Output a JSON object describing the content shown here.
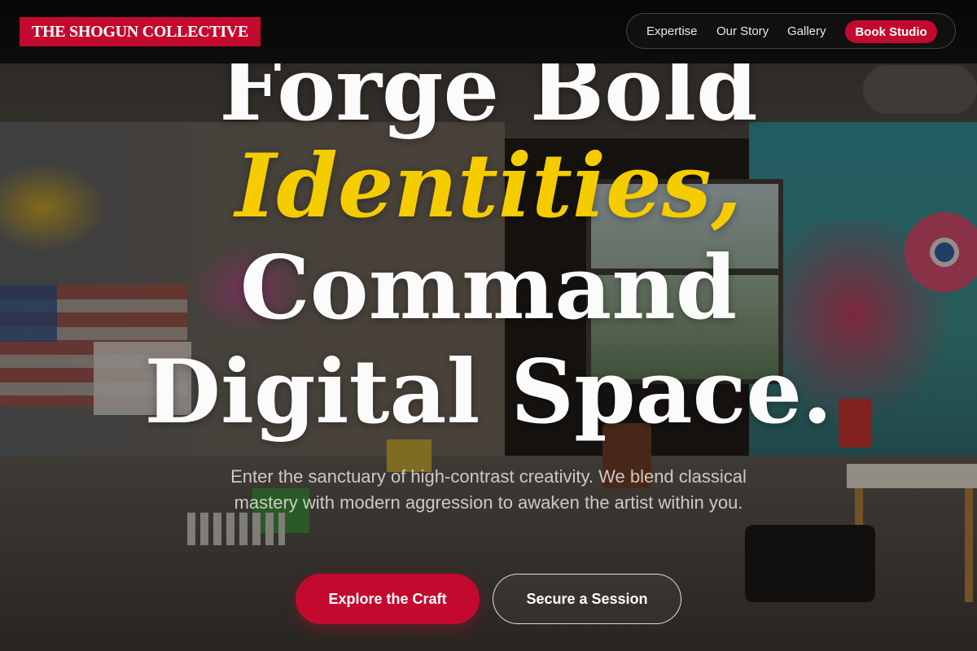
{
  "header": {
    "logo_text": "THE SHOGUN COLLECTIVE",
    "nav_items": [
      "Expertise",
      "Our Story",
      "Gallery"
    ],
    "cta_label": "Book Studio"
  },
  "hero": {
    "line1": "Forge Bold",
    "line2": "Identities,",
    "line3": "Command",
    "line4": "Digital Space.",
    "subtext": "Enter the sanctuary of high-contrast creativity. We blend classical mastery with modern aggression to awaken the artist within you.",
    "primary_button": "Explore the Craft",
    "secondary_button": "Secure a Session"
  },
  "colors": {
    "brand_red": "#c4092f",
    "accent_yellow": "#f5cc00",
    "header_bg": "#0a0a0a"
  },
  "background": {
    "image": "graffiti-art-studio-photo"
  }
}
